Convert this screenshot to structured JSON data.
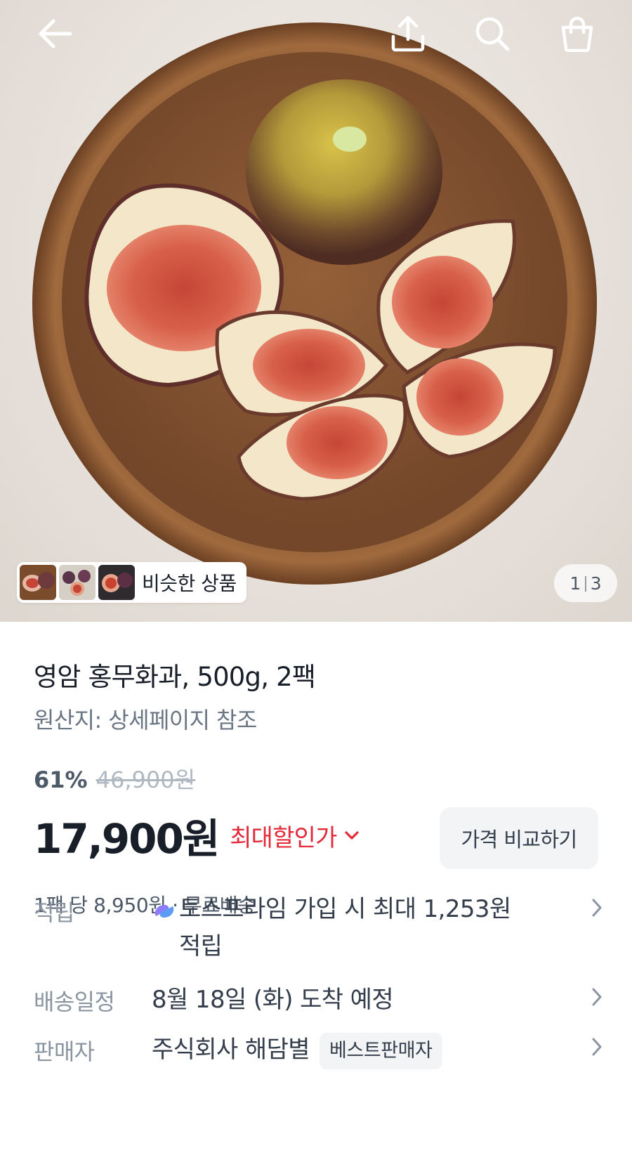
{
  "header": {
    "back_icon": "arrow-left-icon",
    "share_icon": "share-icon",
    "search_icon": "search-icon",
    "cart_icon": "shopping-bag-icon"
  },
  "gallery": {
    "similar_label": "비슷한 상품",
    "current_page": "1",
    "total_pages": "3"
  },
  "product": {
    "title": "영암 홍무화과, 500g, 2팩",
    "origin": "원산지: 상세페이지 참조",
    "discount_rate": "61%",
    "original_price": "46,900원",
    "price": "17,900원",
    "max_discount_label": "최대할인가",
    "compare_button": "가격 비교하기",
    "unit_info": "1팩 당 8,950원 · 무료배송"
  },
  "details": {
    "points": {
      "label": "적립",
      "value": "토스프라임 가입 시 최대 1,253원 적립"
    },
    "shipping": {
      "label": "배송일정",
      "value": "8월 18일 (화) 도착 예정"
    },
    "seller": {
      "label": "판매자",
      "value": "주식회사 해담별",
      "badge": "베스트판매자"
    }
  },
  "colors": {
    "accent_red": "#e42939",
    "text_primary": "#191f28",
    "text_secondary": "#6b7684",
    "button_bg": "#f2f4f6"
  }
}
